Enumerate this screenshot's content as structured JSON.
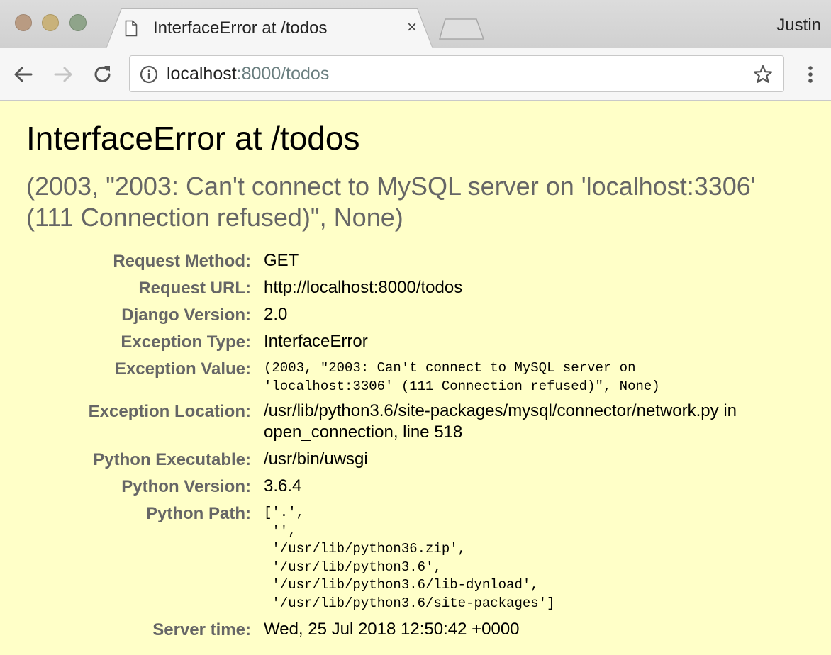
{
  "browser": {
    "tab_title": "InterfaceError at /todos",
    "tab_close": "×",
    "profile_name": "Justin",
    "url_host": "localhost",
    "url_rest": ":8000/todos"
  },
  "page": {
    "title": "InterfaceError at /todos",
    "subtitle": "(2003, \"2003: Can't connect to MySQL server on 'localhost:3306' (111 Connection refused)\", None)",
    "meta": [
      {
        "label": "Request Method:",
        "value": "GET"
      },
      {
        "label": "Request URL:",
        "value": "http://localhost:8000/todos"
      },
      {
        "label": "Django Version:",
        "value": "2.0"
      },
      {
        "label": "Exception Type:",
        "value": "InterfaceError"
      },
      {
        "label": "Exception Value:",
        "value": "(2003, \"2003: Can't connect to MySQL server on\n'localhost:3306' (111 Connection refused)\", None)"
      },
      {
        "label": "Exception Location:",
        "value": "/usr/lib/python3.6/site-packages/mysql/connector/network.py in\nopen_connection, line 518"
      },
      {
        "label": "Python Executable:",
        "value": "/usr/bin/uwsgi"
      },
      {
        "label": "Python Version:",
        "value": "3.6.4"
      },
      {
        "label": "Python Path:",
        "value": "['.',\n '',\n '/usr/lib/python36.zip',\n '/usr/lib/python3.6',\n '/usr/lib/python3.6/lib-dynload',\n '/usr/lib/python3.6/site-packages']"
      },
      {
        "label": "Server time:",
        "value": "Wed, 25 Jul 2018 12:50:42 +0000"
      }
    ]
  },
  "colors": {
    "page_background": "#ffffc8",
    "label_color": "#666666",
    "subtitle_color": "#666666"
  },
  "icons": {
    "tab": "page-icon",
    "back": "arrow-left-icon",
    "forward": "arrow-right-icon",
    "reload": "reload-icon",
    "site_info": "info-icon",
    "bookmark": "star-icon",
    "menu": "kebab-menu-icon"
  }
}
